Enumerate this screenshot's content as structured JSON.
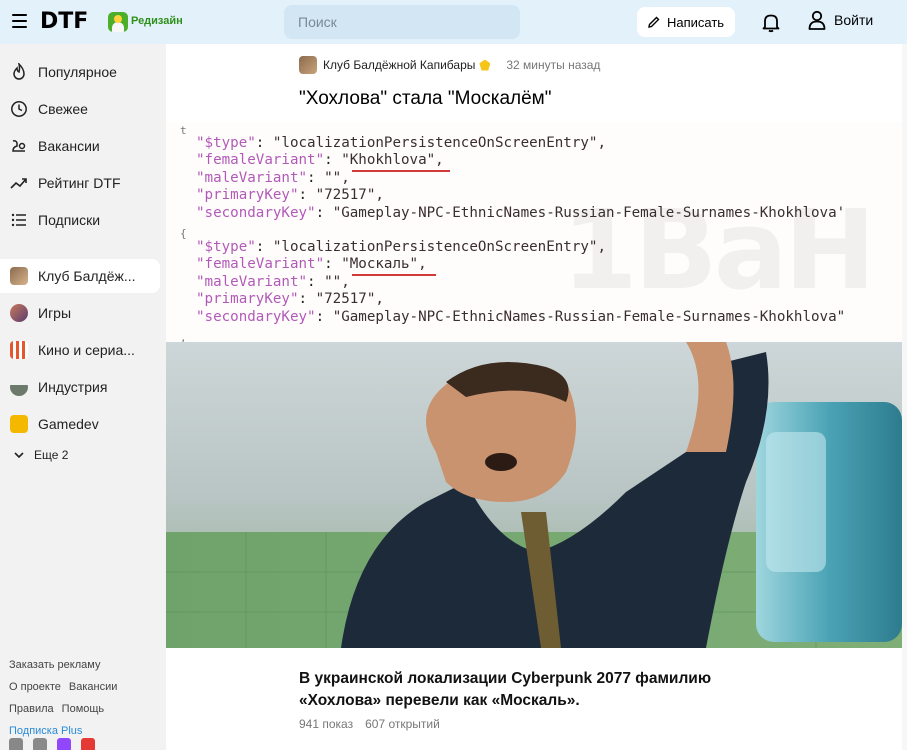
{
  "header": {
    "logo": "DTF",
    "redesign_label": "Редизайн",
    "search_placeholder": "Поиск",
    "write_label": "Написать",
    "login_label": "Войти"
  },
  "sidebar": {
    "items": [
      {
        "label": "Популярное",
        "icon": "flame-icon"
      },
      {
        "label": "Свежее",
        "icon": "clock-icon"
      },
      {
        "label": "Вакансии",
        "icon": "briefcase-icon"
      },
      {
        "label": "Рейтинг DTF",
        "icon": "trend-icon"
      },
      {
        "label": "Подписки",
        "icon": "list-icon"
      }
    ],
    "subsites": [
      {
        "label": "Клуб Балдёж...",
        "color": "#8b6a4e",
        "active": true
      },
      {
        "label": "Игры",
        "color": "#b35c4a"
      },
      {
        "label": "Кино и сериа...",
        "color": "#e5572c"
      },
      {
        "label": "Индустрия",
        "color": "#6b7a6a"
      },
      {
        "label": "Gamedev",
        "color": "#f5b800"
      }
    ],
    "more_label": "Еще 2",
    "footer": {
      "ads": "Заказать рекламу",
      "about": "О проекте",
      "jobs": "Вакансии",
      "rules": "Правила",
      "help": "Помощь",
      "plus": "Подписка Plus"
    }
  },
  "post": {
    "club_name": "Клуб Балдёжной Капибары",
    "time": "32 минуты назад",
    "title": "\"Хохлова\" стала \"Москалём\"",
    "code_block_1": {
      "line1_key": "\"$type\"",
      "line1_val": "\"localizationPersistenceOnScreenEntry\",",
      "line2_key": "\"femaleVariant\"",
      "line2_val": "\"Khokhlova\",",
      "line3_key": "\"maleVariant\"",
      "line3_val": "\"\",",
      "line4_key": "\"primaryKey\"",
      "line4_val": "\"72517\",",
      "line5_key": "\"secondaryKey\"",
      "line5_val": "\"Gameplay-NPC-EthnicNames-Russian-Female-Surnames-Khokhlova'"
    },
    "code_block_2": {
      "line1_key": "\"$type\"",
      "line1_val": "\"localizationPersistenceOnScreenEntry\",",
      "line2_key": "\"femaleVariant\"",
      "line2_val": "\"Москаль\",",
      "line3_key": "\"maleVariant\"",
      "line3_val": "\"\",",
      "line4_key": "\"primaryKey\"",
      "line4_val": "\"72517\",",
      "line5_key": "\"secondaryKey\"",
      "line5_val": "\"Gameplay-NPC-EthnicNames-Russian-Female-Surnames-Khokhlova\""
    },
    "caption": "В украинской локализации Cyberpunk 2077 фамилию «Хохлова» перевели как «Москаль».",
    "views": "941 показ",
    "opens": "607 открытий"
  },
  "colors": {
    "header_bg": "#e3f1fb",
    "json_key": "#b25ab9",
    "underline": "#d23a3a",
    "plus_link": "#2a8bd8"
  }
}
